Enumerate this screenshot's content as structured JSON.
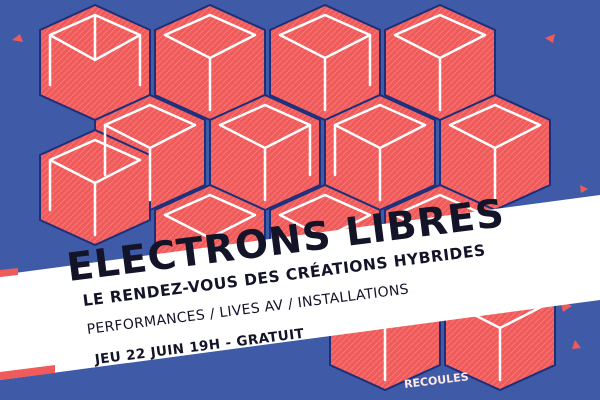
{
  "poster": {
    "title": "ELECTRONS LIBRES",
    "subtitle": "LE RENDEZ-VOUS DES CRÉATIONS HYBRIDES",
    "program": "PERFORMANCES / LIVES AV / INSTALLATIONS",
    "date": "JEU 22 JUIN 19H - GRATUIT",
    "venue": "RECOULES"
  },
  "colors": {
    "background": "#3f5aa6",
    "hexagon_fill": "#ef5b5b",
    "line": "#ffffff",
    "outline": "#1d2f7a",
    "banner": "#ffffff",
    "text": "#141428"
  },
  "icons": [
    "hexagon-cube-pattern",
    "confetti-shapes"
  ]
}
